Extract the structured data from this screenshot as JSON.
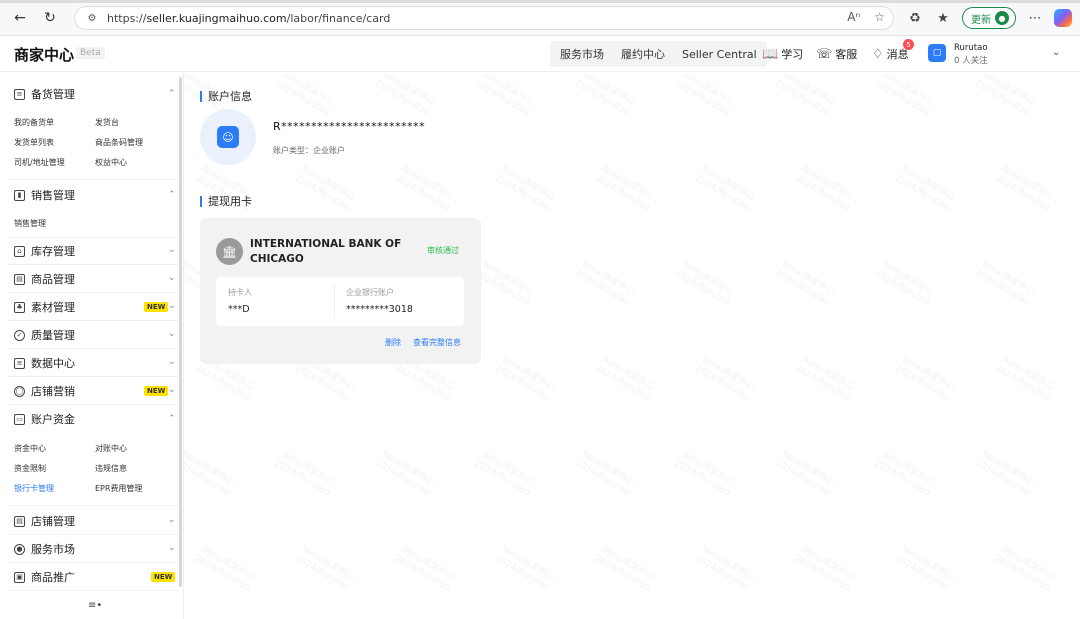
{
  "browser": {
    "url_prefix": "https://",
    "url_domain": "seller.kuajingmaihuo.com",
    "url_path": "/labor/finance/card",
    "update_label": "更新"
  },
  "header": {
    "brand": "商家中心",
    "beta": "Beta",
    "menu": [
      "服务市场",
      "履约中心",
      "Seller Central"
    ],
    "learn": "学习",
    "service": "客服",
    "messages": "消息",
    "message_count": "5",
    "user_name": "Rurutao",
    "user_followers": "0 人关注"
  },
  "sidebar": {
    "sections": [
      {
        "label": "备货管理",
        "icon": "clipboard-icon",
        "expanded": true,
        "items": [
          "我的备货单",
          "发货台",
          "发货单列表",
          "商品条码管理",
          "司机/地址管理",
          "权益中心"
        ]
      },
      {
        "label": "销售管理",
        "icon": "bar-chart-icon",
        "expanded": true,
        "items": [
          "销售管理"
        ]
      },
      {
        "label": "库存管理",
        "icon": "warehouse-icon",
        "expanded": false
      },
      {
        "label": "商品管理",
        "icon": "product-icon",
        "expanded": false
      },
      {
        "label": "素材管理",
        "icon": "material-icon",
        "expanded": false,
        "new": "NEW"
      },
      {
        "label": "质量管理",
        "icon": "shield-check-icon",
        "expanded": false
      },
      {
        "label": "数据中心",
        "icon": "data-icon",
        "expanded": false
      },
      {
        "label": "店铺营销",
        "icon": "marketing-icon",
        "expanded": false,
        "new": "NEW"
      },
      {
        "label": "账户资金",
        "icon": "wallet-icon",
        "expanded": true,
        "items": [
          "资金中心",
          "对账中心",
          "资金限制",
          "违规信息",
          "银行卡管理",
          "EPR费用管理"
        ]
      },
      {
        "label": "店铺管理",
        "icon": "shop-icon",
        "expanded": false
      },
      {
        "label": "服务市场",
        "icon": "service-market-icon",
        "expanded": false
      },
      {
        "label": "商品推广",
        "icon": "promotion-icon",
        "expanded": false,
        "new": "NEW"
      }
    ]
  },
  "main": {
    "account_title": "账户信息",
    "account_name": "R************************",
    "account_type": "账户类型：企业账户",
    "card_title": "提现用卡",
    "card": {
      "bank_name": "INTERNATIONAL BANK OF CHICAGO",
      "status": "审核通过",
      "holder_label": "持卡人",
      "holder_value": "***D",
      "account_label": "企业银行账户",
      "account_value": "*********3018",
      "delete_label": "删除",
      "view_label": "查看完整信息"
    },
    "watermark_lines": [
      "Temu商家中心",
      "2024/Rurutao"
    ]
  },
  "colors": {
    "accent": "#2b7cf6",
    "success": "#2dbd4f",
    "new_tag": "#ffe100"
  }
}
